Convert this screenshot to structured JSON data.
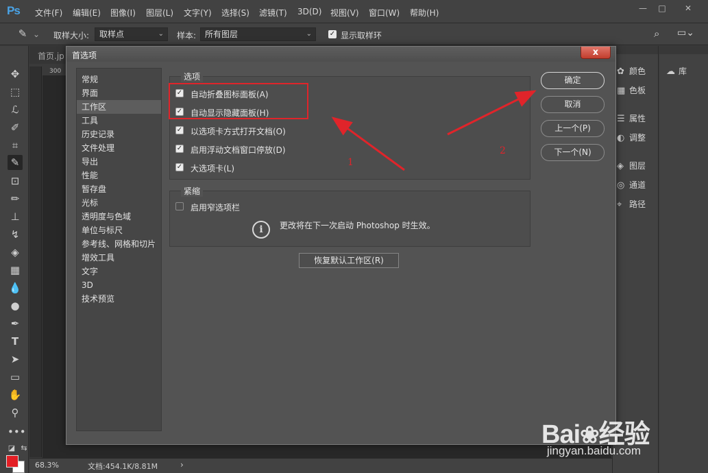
{
  "menubar": {
    "logo": "Ps",
    "items": [
      "文件(F)",
      "编辑(E)",
      "图像(I)",
      "图层(L)",
      "文字(Y)",
      "选择(S)",
      "滤镜(T)",
      "3D(D)",
      "视图(V)",
      "窗口(W)",
      "帮助(H)"
    ]
  },
  "options_bar": {
    "sample_size_label": "取样大小:",
    "sample_size_value": "取样点",
    "sample_label": "样本:",
    "sample_value": "所有图层",
    "show_ring_label": "显示取样环",
    "show_ring_checked": true
  },
  "document": {
    "tab_label": "首页.jp",
    "ruler_number": "300",
    "zoom": "68.3%",
    "doc_size": "文档:454.1K/8.81M"
  },
  "right_panels": {
    "col1": [
      "颜色",
      "色板",
      "属性",
      "调整",
      "图层",
      "通道",
      "路径"
    ],
    "col2": [
      "库"
    ]
  },
  "dialog": {
    "title": "首选项",
    "close_label": "x",
    "nav_items": [
      "常规",
      "界面",
      "工作区",
      "工具",
      "历史记录",
      "文件处理",
      "导出",
      "性能",
      "暂存盘",
      "光标",
      "透明度与色域",
      "单位与标尺",
      "参考线、网格和切片",
      "增效工具",
      "文字",
      "3D",
      "技术预览"
    ],
    "selected_nav": "工作区",
    "options_group": {
      "title": "选项",
      "items": [
        {
          "label": "自动折叠图标面板(A)",
          "checked": true
        },
        {
          "label": "自动显示隐藏面板(H)",
          "checked": true
        },
        {
          "label": "以选项卡方式打开文档(O)",
          "checked": true
        },
        {
          "label": "启用浮动文档窗口停放(D)",
          "checked": true
        },
        {
          "label": "大选项卡(L)",
          "checked": true
        }
      ]
    },
    "compact_group": {
      "title": "紧缩",
      "items": [
        {
          "label": "启用窄选项栏",
          "checked": false
        }
      ],
      "info_text": "更改将在下一次启动 Photoshop 时生效。"
    },
    "reset_button": "恢复默认工作区(R)",
    "buttons": {
      "ok": "确定",
      "cancel": "取消",
      "prev": "上一个(P)",
      "next": "下一个(N)"
    }
  },
  "annotations": {
    "num1": "1",
    "num2": "2",
    "color": "#e0242a"
  },
  "watermark": {
    "main": "Bai",
    "main2": "经验",
    "sub": "jingyan.baidu.com"
  }
}
